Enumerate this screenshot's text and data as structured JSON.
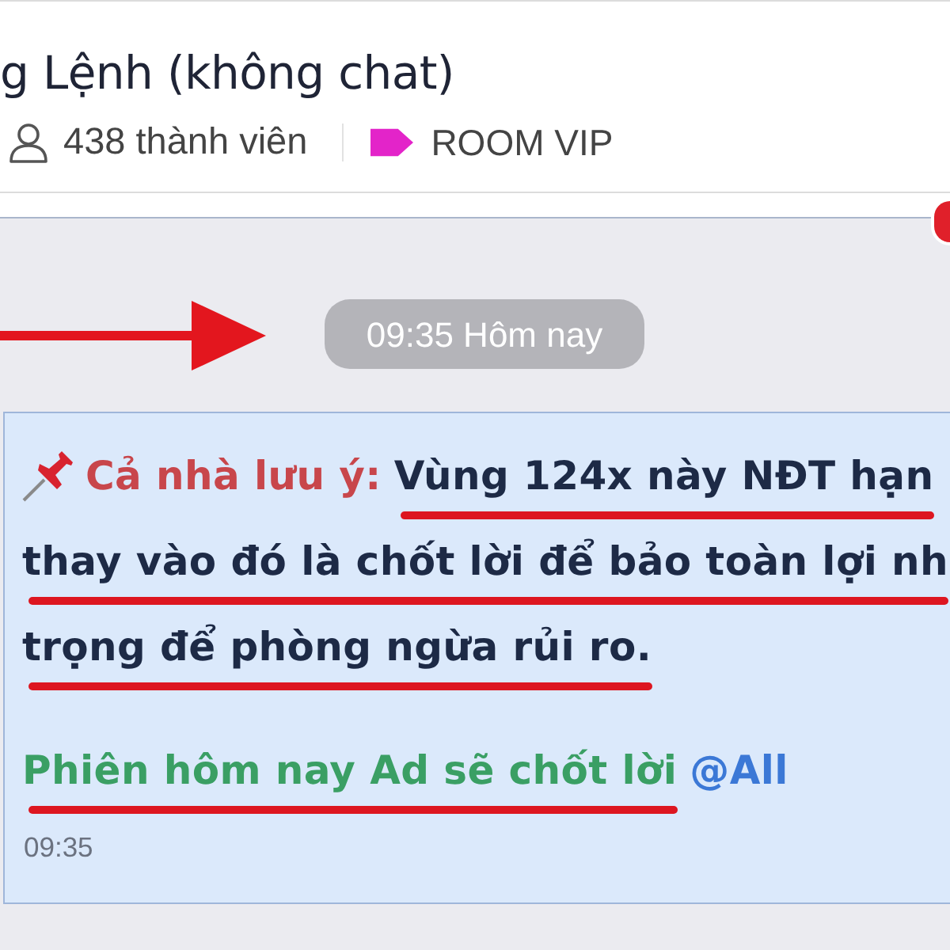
{
  "header": {
    "title": "g Lệnh (không chat)",
    "members": "438 thành viên",
    "tag": "ROOM VIP"
  },
  "chat": {
    "date_divider": "09:35 Hôm nay",
    "message": {
      "lines": [
        [
          {
            "kind": "label",
            "text": "Cả nhà lưu ý:",
            "underlined": false
          },
          {
            "kind": "body",
            "text": "Vùng 124x này NĐT hạn",
            "underlined": true
          }
        ],
        [
          {
            "kind": "body",
            "text": "thay vào đó là chốt lời để bảo toàn lợi nh",
            "underlined": true
          }
        ],
        [
          {
            "kind": "body",
            "text": "trọng để phòng ngừa rủi ro.",
            "underlined": true
          }
        ],
        [
          {
            "kind": "highlight",
            "text": "Phiên hôm nay Ad sẽ chốt lời",
            "underlined": true
          },
          {
            "kind": "mention",
            "text": "@All",
            "underlined": false
          }
        ]
      ],
      "time": "09:35"
    }
  }
}
